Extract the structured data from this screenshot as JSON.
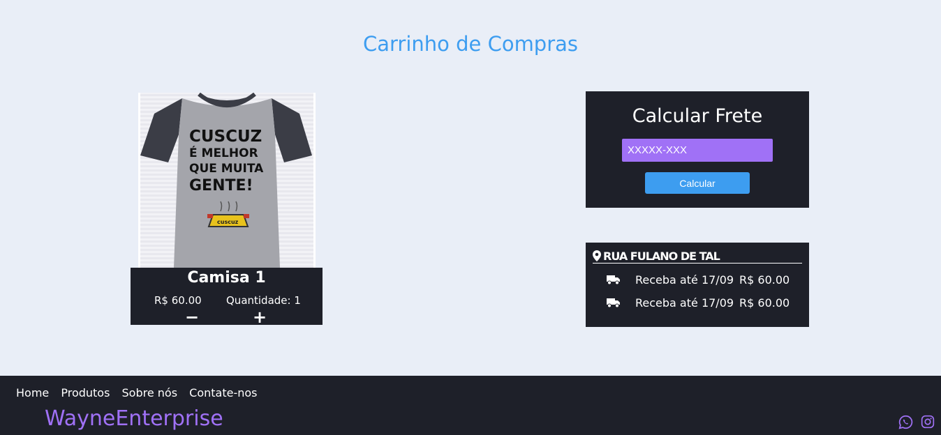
{
  "page": {
    "title": "Carrinho de Compras"
  },
  "product": {
    "image_alt": "Camiseta Cuscuz é melhor que muita gente",
    "shirt_text": [
      "CUSCUZ",
      "É MELHOR",
      "QUE MUITA",
      "GENTE!"
    ],
    "pot_text": "cuscuz",
    "name": "Camisa 1",
    "price": "R$ 60.00",
    "quantity_label": "Quantidade: 1",
    "minus_label": "−",
    "plus_label": "+"
  },
  "freight": {
    "title": "Calcular Frete",
    "cep_placeholder": "XXXXX-XXX",
    "button_label": "Calcular"
  },
  "delivery": {
    "address": "RUA FULANO DE TAL",
    "options": [
      {
        "date": "Receba até 17/09",
        "price": "R$ 60.00"
      },
      {
        "date": "Receba até 17/09",
        "price": "R$ 60.00"
      }
    ]
  },
  "footer": {
    "nav": [
      "Home",
      "Produtos",
      "Sobre nós",
      "Contate-nos"
    ],
    "brand": "WayneEnterprise",
    "social": [
      "whatsapp-icon",
      "instagram-icon"
    ]
  },
  "colors": {
    "background": "#e9eef7",
    "dark": "#1e2029",
    "accent_blue": "#3d9df0",
    "accent_purple": "#a071f6"
  }
}
